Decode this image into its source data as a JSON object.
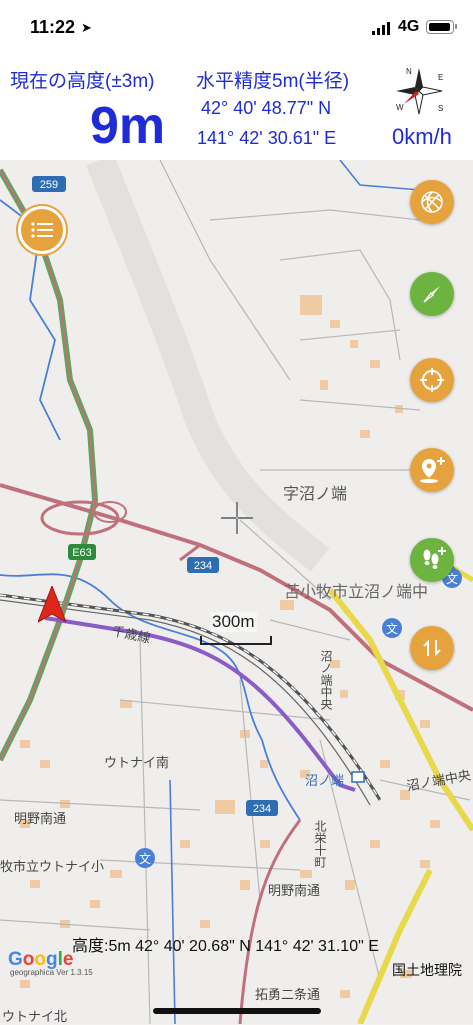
{
  "status_bar": {
    "time": "11:22",
    "carrier": "4G"
  },
  "info": {
    "altitude_label": "現在の高度(±3m)",
    "altitude_value": "9m",
    "accuracy_label": "水平精度5m(半径)",
    "latitude": "42° 40' 48.77\" N",
    "longitude": "141° 42' 30.61\" E",
    "speed": "0km/h",
    "compass_letters": {
      "n": "N",
      "e": "E",
      "s": "S",
      "w": "W"
    }
  },
  "map": {
    "labels": {
      "route_259": "259",
      "route_234_a": "234",
      "route_234_b": "234",
      "e63": "E63",
      "area_aza_numanohata": "字沼ノ端",
      "school_numanohata": "苫小牧市立沼ノ端中",
      "chitose_line": "千歳線",
      "utonai_minami": "ウトナイ南",
      "meino_minamidori": "明野南通",
      "school_utonai": "牧市立ウトナイ小",
      "station_numanohata": "沼ノ端",
      "numanohata_naka": "沼ノ端中央",
      "meino_minamidori_2": "明野南通",
      "takuyu_nijodori": "拓勇二条通",
      "utonai_kita": "ウトナイ北",
      "numanohata_chuo_v": "沼ノ端中央",
      "kita_jumonji": "北栄十町"
    },
    "scale_label": "300m",
    "bottom_readout": "高度:5m  42° 40' 20.68\" N 141° 42' 31.10\" E",
    "google_logo": "Google",
    "geo_version": "geographica Ver 1.3.15",
    "gsi_credit": "国土地理院"
  },
  "controls": {
    "menu_icon": "list-icon",
    "fab_icons": [
      "spiral-icon",
      "compass-needle-icon",
      "crosshair-target-icon",
      "add-pin-icon",
      "add-footprints-icon",
      "switch-arrows-icon"
    ]
  },
  "colors": {
    "accent_blue": "#1e2bd6",
    "fab_orange": "#e6a23c",
    "fab_green": "#6cb43f",
    "track_purple": "#8a5bc9",
    "location_red": "#e0261a"
  }
}
